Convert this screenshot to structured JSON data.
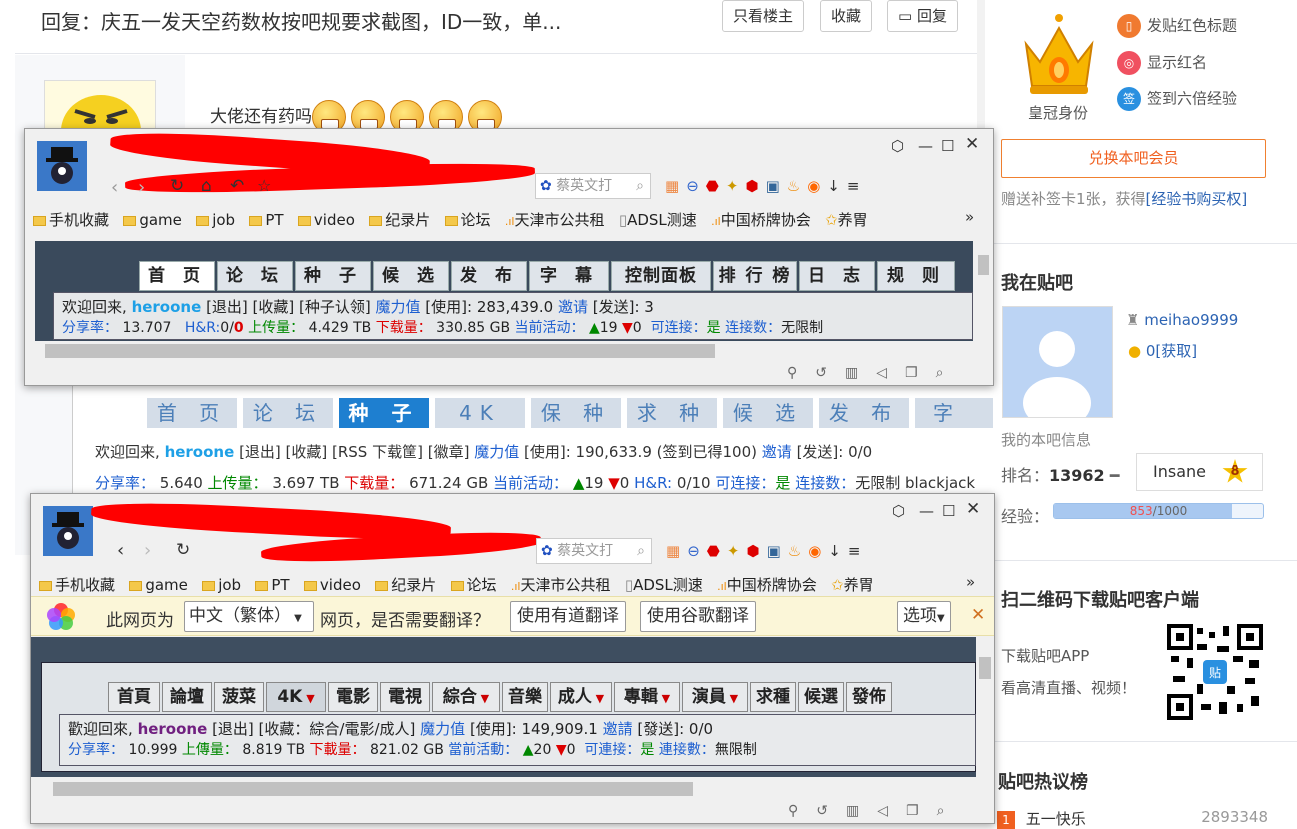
{
  "post": {
    "title": "回复：庆五一发天空药数枚按吧规要求截图，ID一致，单...",
    "only_op": "只看楼主",
    "collect": "收藏",
    "reply": "回复",
    "reply_text": "大佬还有药吗"
  },
  "sidebar": {
    "perks": [
      "发贴红色标题",
      "显示红名",
      "签到六倍经验"
    ],
    "crown_label": "皇冠身份",
    "member_button": "兑换本吧会员",
    "bonus_text": "赠送补签卡1张，获得",
    "bonus_link": "[经验书购买权]",
    "my_bar_title": "我在贴吧",
    "username": "meihao9999",
    "coins": "0",
    "get_link": "[获取]",
    "my_info": "我的本吧信息",
    "rank_label": "排名：",
    "rank_value": "13962",
    "level_name": "Insane",
    "level_num": "8",
    "exp_label": "经验：",
    "exp_current": "853",
    "exp_total": "/1000",
    "exp_progress": 0.853,
    "qr_title": "扫二维码下载贴吧客户端",
    "qr_line1": "下载贴吧APP",
    "qr_line2": "看高清直播、视频！",
    "hot_title": "贴吧热议榜",
    "hot_items": [
      {
        "rank": "1",
        "title": "五一快乐",
        "count": "2893348"
      }
    ]
  },
  "browser1": {
    "search_placeholder": "蔡英文打",
    "bookmarks": [
      "手机收藏",
      "game",
      "job",
      "PT",
      "video",
      "纪录片",
      "论坛",
      "天津市公共租",
      "ADSL测速",
      "中国桥牌协会",
      "养胃"
    ],
    "tabs": [
      "首 页",
      "论 坛",
      "种 子",
      "候 选",
      "发 布",
      "字 幕",
      "控制面板",
      "排 行 榜",
      "日 志",
      "规 则"
    ],
    "welcome": "欢迎回来,",
    "user": "heroone",
    "links": "[退出] [收藏] [种子认领]",
    "magic": "魔力值",
    "used": "[使用]: 283,439.0",
    "invite": "邀请",
    "sent": "[发送]: 3",
    "ratio_label": "分享率：",
    "ratio": "13.707",
    "hr": "H&R:",
    "hr_val": "0/",
    "hr_zero": "0",
    "up_label": "上传量：",
    "up": "4.429 TB",
    "down_label": "下载量：",
    "down": "330.85 GB",
    "active": "当前活动：",
    "active_val": "19",
    "active_val2": "0",
    "conn": "可连接：",
    "conn_val": "是",
    "conncount": "连接数：",
    "conncount_val": "无限制"
  },
  "browser_mid": {
    "tabs": [
      "首 页",
      "论 坛",
      "种 子",
      "4K",
      "保 种",
      "求 种",
      "候 选",
      "发 布",
      "字 幕"
    ],
    "welcome": "欢迎回来,",
    "user": "heroone",
    "links": "[退出] [收藏] [RSS 下载筐] [徽章]",
    "magic": "魔力值",
    "used": "[使用]: 190,633.9 (签到已得100)",
    "invite": "邀请",
    "sent": "[发送]: 0/0",
    "ratio_label": "分享率：",
    "ratio": "5.640",
    "up_label": "上传量：",
    "up": "3.697 TB",
    "down_label": "下载量：",
    "down": "671.24 GB",
    "active": "当前活动：",
    "active_val": "19",
    "active_val2": "0",
    "hr": "H&R:",
    "hr_val": "0/10",
    "conn": "可连接：",
    "conn_val": "是",
    "conncount": "连接数：",
    "conncount_val": "无限制",
    "extra": "blackjack"
  },
  "browser2": {
    "search_placeholder": "蔡英文打",
    "bookmarks": [
      "手机收藏",
      "game",
      "job",
      "PT",
      "video",
      "纪录片",
      "论坛",
      "天津市公共租",
      "ADSL测速",
      "中国桥牌协会",
      "养胃"
    ],
    "translate_prefix": "此网页为",
    "translate_lang": "中文（繁体）",
    "translate_suffix": "网页，是否需要翻译？",
    "youdao": "使用有道翻译",
    "google": "使用谷歌翻译",
    "options": "选项",
    "tabs": [
      "首頁",
      "論壇",
      "菠菜",
      "4K",
      "電影",
      "電視",
      "綜合",
      "音樂",
      "成人",
      "專輯",
      "演員",
      "求種",
      "候選",
      "發佈"
    ],
    "welcome": "歡迎回來,",
    "user": "heroone",
    "links": "[退出] [收藏：綜合/電影/成人]",
    "magic": "魔力值",
    "used": "[使用]: 149,909.1",
    "invite": "邀請",
    "sent": "[發送]: 0/0",
    "ratio_label": "分享率：",
    "ratio": "10.999",
    "up_label": "上傳量：",
    "up": "8.819 TB",
    "down_label": "下載量：",
    "down": "821.02 GB",
    "active": "當前活動：",
    "active_val": "20",
    "active_val2": "0",
    "conn": "可連接：",
    "conn_val": "是",
    "conncount": "連接數：",
    "conncount_val": "無限制"
  }
}
